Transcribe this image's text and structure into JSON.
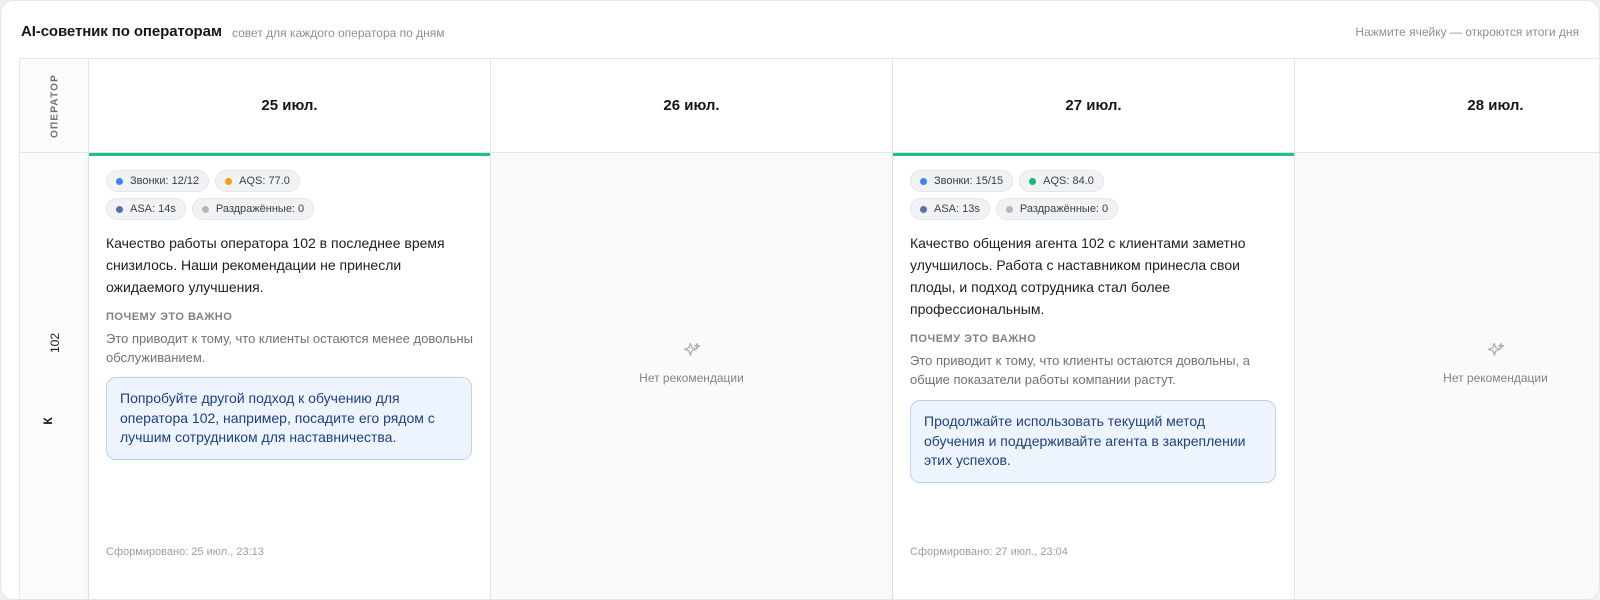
{
  "header": {
    "title": "AI-советник по операторам",
    "subtitle": "совет для каждого оператора по дням",
    "hint": "Нажмите ячейку — откроются итоги дня"
  },
  "grid": {
    "corner_label": "ОПЕРАТОР",
    "operator": {
      "name": "102",
      "initial": "К"
    },
    "days": [
      {
        "date": "25 июл.",
        "has_advice": true,
        "chips": [
          {
            "label": "Звонки: 12/12",
            "color": "#3b82f6"
          },
          {
            "label": "AQS: 77.0",
            "color": "#f59e0b"
          },
          {
            "label": "ASA: 14s",
            "color": "#5b6fa8"
          },
          {
            "label": "Раздражённые: 0",
            "color": "#b4b8be"
          }
        ],
        "summary": "Качество работы оператора 102 в последнее время снизилось. Наши рекомендации не принесли ожидаемого улучшения.",
        "why_label": "ПОЧЕМУ ЭТО ВАЖНО",
        "why_text": "Это приводит к тому, что клиенты остаются менее довольны обслуживанием.",
        "advice": "Попробуйте другой подход к обучению для оператора 102, например, посадите его рядом с лучшим сотрудником для наставничества.",
        "generated": "Сформировано: 25 июл., 23:13"
      },
      {
        "date": "26 июл.",
        "has_advice": false,
        "empty_text": "Нет рекомендации"
      },
      {
        "date": "27 июл.",
        "has_advice": true,
        "chips": [
          {
            "label": "Звонки: 15/15",
            "color": "#3b82f6"
          },
          {
            "label": "AQS: 84.0",
            "color": "#10b981"
          },
          {
            "label": "ASA: 13s",
            "color": "#5b6fa8"
          },
          {
            "label": "Раздражённые: 0",
            "color": "#b4b8be"
          }
        ],
        "summary": "Качество общения агента 102 с клиентами заметно улучшилось. Работа с наставником принесла свои плоды, и подход сотрудника стал более профессиональным.",
        "why_label": "ПОЧЕМУ ЭТО ВАЖНО",
        "why_text": "Это приводит к тому, что клиенты остаются довольны, а общие показатели работы компании растут.",
        "advice": "Продолжайте использовать текущий метод обучения и поддерживайте агента в закреплении этих успехов.",
        "generated": "Сформировано: 27 июл., 23:04"
      },
      {
        "date": "28 июл.",
        "has_advice": false,
        "empty_text": "Нет рекомендации"
      }
    ]
  }
}
